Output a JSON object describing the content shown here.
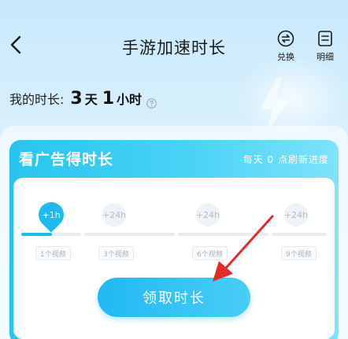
{
  "header": {
    "title": "手游加速时长",
    "exchange_label": "兑换",
    "detail_label": "明细"
  },
  "my_time": {
    "label": "我的时长:",
    "days": "3",
    "days_unit": "天",
    "hours": "1",
    "hours_unit": "小时"
  },
  "ad_card": {
    "title": "看广告得时长",
    "note": "每天 0 点刷新进度",
    "steps": [
      {
        "reward": "+1h",
        "label": "1个视频",
        "active": true
      },
      {
        "reward": "+24h",
        "label": "3个视频",
        "active": false
      },
      {
        "reward": "+24h",
        "label": "6个视频",
        "active": false
      },
      {
        "reward": "+24h",
        "label": "9个视频",
        "active": false
      }
    ],
    "progress": 0.1,
    "claim_label": "领取时长"
  },
  "colors": {
    "accent": "#1eb9f0",
    "card_gradient_start": "#28c4ef",
    "annotation_arrow": "#e62a2a"
  }
}
